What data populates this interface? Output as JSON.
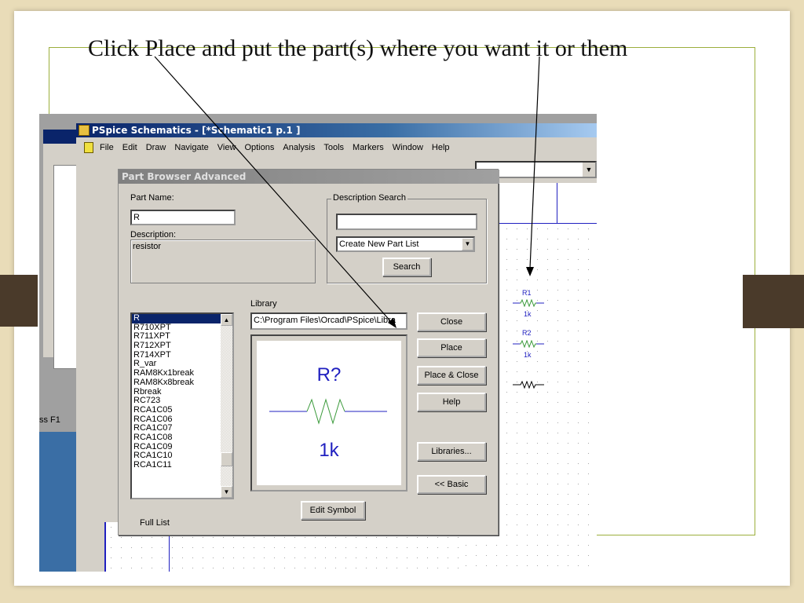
{
  "slide": {
    "caption": "Click Place and put the part(s) where you want it or them"
  },
  "back_window": {
    "status_text": "ss F1"
  },
  "window": {
    "title": "PSpice Schematics - [*Schematic1  p.1  ]",
    "menu": [
      "File",
      "Edit",
      "Draw",
      "Navigate",
      "View",
      "Options",
      "Analysis",
      "Tools",
      "Markers",
      "Window",
      "Help"
    ]
  },
  "dialog": {
    "title": "Part Browser Advanced",
    "part_name_label": "Part Name:",
    "part_name_value": "R",
    "description_label": "Description:",
    "description_value": "resistor",
    "description_search_label": "Description Search",
    "search_value": "",
    "list_select": "Create New Part List",
    "search_button": "Search",
    "library_label": "Library",
    "library_path": "C:\\Program Files\\Orcad\\PSpice\\Libra",
    "parts": [
      "R",
      "R710XPT",
      "R711XPT",
      "R712XPT",
      "R714XPT",
      "R_var",
      "RAM8Kx1break",
      "RAM8Kx8break",
      "Rbreak",
      "RC723",
      "RCA1C05",
      "RCA1C06",
      "RCA1C07",
      "RCA1C08",
      "RCA1C09",
      "RCA1C10",
      "RCA1C11"
    ],
    "preview": {
      "ref": "R?",
      "value": "1k"
    },
    "buttons": {
      "close": "Close",
      "place": "Place",
      "place_close": "Place & Close",
      "help": "Help",
      "libraries": "Libraries...",
      "basic": "<< Basic",
      "edit_symbol": "Edit Symbol"
    },
    "full_list_label": "Full List"
  },
  "schematic": {
    "parts": [
      {
        "ref": "R1",
        "value": "1k"
      },
      {
        "ref": "R2",
        "value": "1k"
      }
    ]
  }
}
